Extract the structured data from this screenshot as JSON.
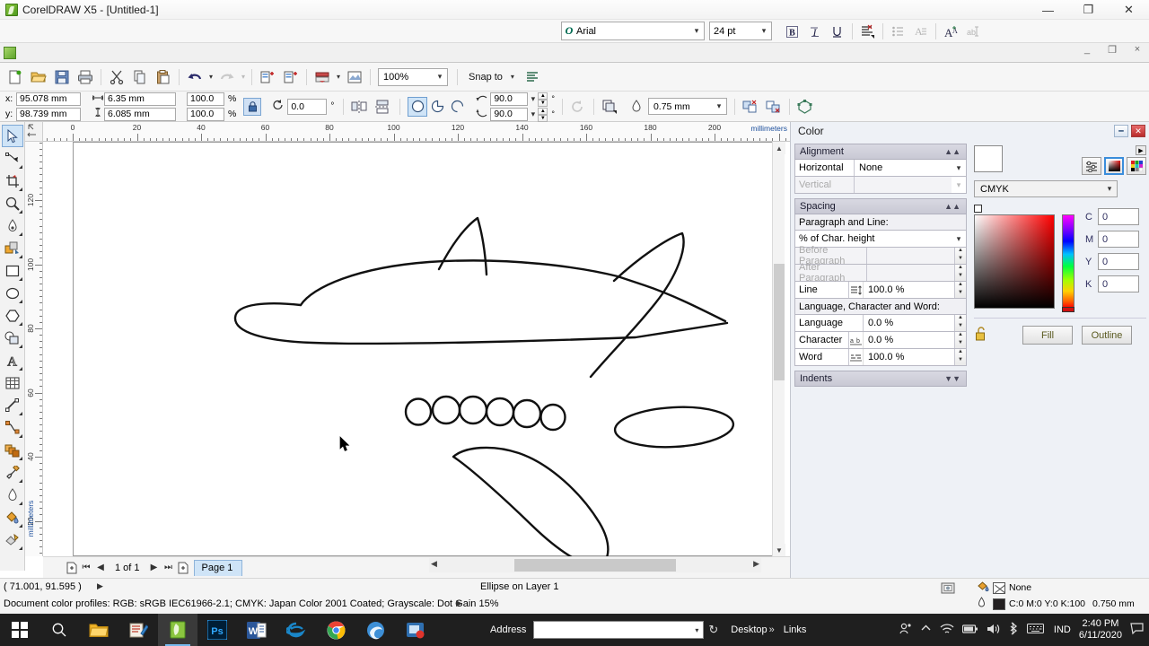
{
  "window": {
    "title": "CorelDRAW X5 - [Untitled-1]",
    "app_icon": "coreldraw-icon",
    "minimize": "—",
    "maximize": "❐",
    "close": "✕",
    "inner_minimize": "_",
    "inner_restore": "❐",
    "inner_close": "×"
  },
  "text_propertybar": {
    "font_family": "Arial",
    "font_size": "24 pt",
    "bold": "B",
    "italic": "I",
    "underline": "U",
    "buttons": [
      {
        "name": "bold-button",
        "label": "B"
      },
      {
        "name": "italic-button",
        "label": "I"
      },
      {
        "name": "underline-button",
        "label": "U"
      },
      {
        "name": "text-align-button",
        "label": ""
      },
      {
        "name": "bulleted-list-button",
        "label": ""
      },
      {
        "name": "drop-cap-button",
        "label": ""
      },
      {
        "name": "character-formatting-button",
        "label": ""
      },
      {
        "name": "edit-text-button",
        "label": ""
      }
    ]
  },
  "toolbar": {
    "zoom_level": "100%",
    "snap_to": "Snap to",
    "items": [
      {
        "name": "new-document-button",
        "icon": "new-file-icon"
      },
      {
        "name": "open-document-button",
        "icon": "folder-open-icon"
      },
      {
        "name": "save-document-button",
        "icon": "save-icon"
      },
      {
        "name": "print-button",
        "icon": "printer-icon"
      },
      {
        "name": "cut-button",
        "icon": "scissors-icon"
      },
      {
        "name": "copy-button",
        "icon": "copy-icon"
      },
      {
        "name": "paste-button",
        "icon": "paste-icon"
      },
      {
        "name": "undo-button",
        "icon": "undo-icon"
      },
      {
        "name": "redo-button",
        "icon": "redo-icon"
      },
      {
        "name": "import-button",
        "icon": "import-icon"
      },
      {
        "name": "export-button",
        "icon": "export-icon"
      },
      {
        "name": "application-launcher-button",
        "icon": "launcher-icon"
      },
      {
        "name": "corel-connect-button",
        "icon": "connect-icon"
      },
      {
        "name": "options-button",
        "icon": "options-icon"
      }
    ]
  },
  "property_bar": {
    "x_label": "x:",
    "y_label": "y:",
    "x_value": "95.078 mm",
    "y_value": "98.739 mm",
    "width_value": "6.35 mm",
    "height_value": "6.085 mm",
    "scale_h": "100.0",
    "scale_v": "100.0",
    "percent": "%",
    "lock_ratio": "lock-icon",
    "rotation": "0.0",
    "degree": "°",
    "ellipse_mode": "ellipse",
    "start_angle": "90.0",
    "end_angle": "90.0",
    "outline_width": "0.75 mm",
    "shape_buttons": [
      {
        "name": "ellipse-tool-button",
        "icon": "circle-icon",
        "selected": true
      },
      {
        "name": "pie-tool-button",
        "icon": "pie-icon",
        "selected": false
      },
      {
        "name": "arc-tool-button",
        "icon": "arc-icon",
        "selected": false
      }
    ]
  },
  "toolbox": [
    {
      "name": "pick-tool",
      "icon": "arrow-cursor-icon",
      "selected": true
    },
    {
      "name": "shape-tool",
      "icon": "shape-node-icon",
      "selected": false
    },
    {
      "name": "crop-tool",
      "icon": "crop-icon",
      "selected": false
    },
    {
      "name": "zoom-tool",
      "icon": "magnifier-icon",
      "selected": false
    },
    {
      "name": "freehand-tool",
      "icon": "pen-icon",
      "selected": false
    },
    {
      "name": "smart-fill-tool",
      "icon": "smart-fill-icon",
      "selected": false
    },
    {
      "name": "rectangle-tool",
      "icon": "rectangle-icon",
      "selected": false
    },
    {
      "name": "ellipse-tool",
      "icon": "ellipse-icon",
      "selected": false
    },
    {
      "name": "polygon-tool",
      "icon": "polygon-icon",
      "selected": false
    },
    {
      "name": "basic-shapes-tool",
      "icon": "basic-shapes-icon",
      "selected": false
    },
    {
      "name": "text-tool",
      "icon": "letter-a-icon",
      "selected": false
    },
    {
      "name": "table-tool",
      "icon": "table-grid-icon",
      "selected": false
    },
    {
      "name": "dimension-tool",
      "icon": "dimension-icon",
      "selected": false
    },
    {
      "name": "connector-tool",
      "icon": "connector-icon",
      "selected": false
    },
    {
      "name": "blend-tool",
      "icon": "blend-icon",
      "selected": false
    },
    {
      "name": "color-eyedropper-tool",
      "icon": "eyedropper-icon",
      "selected": false
    },
    {
      "name": "outline-tool",
      "icon": "outline-pen-icon",
      "selected": false
    },
    {
      "name": "fill-tool",
      "icon": "fill-bucket-icon",
      "selected": false
    },
    {
      "name": "interactive-fill-tool",
      "icon": "interactive-fill-icon",
      "selected": false
    }
  ],
  "rulers": {
    "units": "millimeters",
    "h_ticks": [
      0,
      20,
      40,
      60,
      80,
      100,
      120,
      140,
      160,
      180,
      200
    ],
    "v_ticks": [
      120,
      100,
      80,
      60,
      40,
      20
    ]
  },
  "page_navigator": {
    "page_counter": "1 of 1",
    "page_tab": "Page 1",
    "first": "⏮",
    "prev": "◀",
    "next": "▶",
    "last": "⏭",
    "add_page_before": "add-page-before-icon",
    "add_page_after": "add-page-after-icon"
  },
  "docker": {
    "title": "Color",
    "text_panel": {
      "alignment": {
        "header": "Alignment",
        "horizontal_label": "Horizontal",
        "horizontal_value": "None",
        "vertical_label": "Vertical",
        "vertical_value": ""
      },
      "spacing": {
        "header": "Spacing",
        "paragraph_and_line": "Paragraph and Line:",
        "units": "% of Char. height",
        "before_paragraph_label": "Before Paragraph",
        "before_paragraph_value": "",
        "after_paragraph_label": "After Paragraph",
        "after_paragraph_value": "",
        "line_label": "Line",
        "line_value": "100.0 %",
        "lcw_header": "Language, Character and Word:",
        "language_label": "Language",
        "language_value": "0.0 %",
        "character_label": "Character",
        "character_value": "0.0 %",
        "word_label": "Word",
        "word_value": "100.0 %"
      },
      "indents": {
        "header": "Indents"
      }
    },
    "color_panel": {
      "mode": "CMYK",
      "c_label": "C",
      "c_value": "0",
      "m_label": "M",
      "m_value": "0",
      "y_label": "Y",
      "y_value": "0",
      "k_label": "K",
      "k_value": "0",
      "fill_button": "Fill",
      "outline_button": "Outline",
      "swatch_color": "#ffffff",
      "lock_icon": "unlock-icon",
      "view_buttons": [
        {
          "name": "color-sliders-button",
          "icon": "sliders-icon"
        },
        {
          "name": "color-viewers-button",
          "icon": "color-square-icon",
          "selected": true
        },
        {
          "name": "color-palettes-button",
          "icon": "palette-grid-icon"
        }
      ]
    }
  },
  "status_bar": {
    "coordinates": "( 71.001, 91.595 )",
    "object_info": "Ellipse on Layer 1",
    "color_profiles": "Document color profiles: RGB: sRGB IEC61966-2.1; CMYK: Japan Color 2001 Coated; Grayscale: Dot Gain 15%",
    "fill_value": "None",
    "outline_value": "C:0 M:0 Y:0 K:100",
    "outline_width": "0.750 mm",
    "arrow": "▶"
  },
  "taskbar": {
    "start": "start-button",
    "search": "search-icon",
    "items": [
      {
        "name": "taskbar-file-explorer",
        "icon": "folder-icon"
      },
      {
        "name": "taskbar-paint-app",
        "icon": "paint-icon"
      },
      {
        "name": "taskbar-coreldraw",
        "icon": "coreldraw-icon",
        "active": true
      },
      {
        "name": "taskbar-photoshop",
        "icon": "photoshop-icon",
        "label": "Ps"
      },
      {
        "name": "taskbar-word",
        "icon": "word-icon",
        "label": "W"
      },
      {
        "name": "taskbar-internet-explorer",
        "icon": "ie-icon"
      },
      {
        "name": "taskbar-chrome",
        "icon": "chrome-icon"
      },
      {
        "name": "taskbar-edge",
        "icon": "edge-icon"
      },
      {
        "name": "taskbar-screen-recorder",
        "icon": "recorder-icon"
      }
    ],
    "address_label": "Address",
    "address_value": "",
    "toolbar_overflow": "»",
    "desktop_label": "Desktop",
    "links_label": "Links",
    "tray": [
      {
        "name": "tray-people-icon",
        "icon": "people-icon"
      },
      {
        "name": "tray-show-hidden-icons",
        "icon": "chevron-up-icon"
      },
      {
        "name": "tray-network-icon",
        "icon": "wifi-icon"
      },
      {
        "name": "tray-battery-icon",
        "icon": "battery-icon"
      },
      {
        "name": "tray-volume-icon",
        "icon": "speaker-icon"
      },
      {
        "name": "tray-bluetooth-icon",
        "icon": "bluetooth-icon"
      },
      {
        "name": "tray-keyboard-icon",
        "icon": "keyboard-icon"
      }
    ],
    "language": "IND",
    "time": "2:40 PM",
    "date": "6/11/2020",
    "notifications": "notification-icon"
  },
  "canvas": {
    "drawing_name": "airplane-line-drawing",
    "cursor": "mouse-pointer"
  }
}
